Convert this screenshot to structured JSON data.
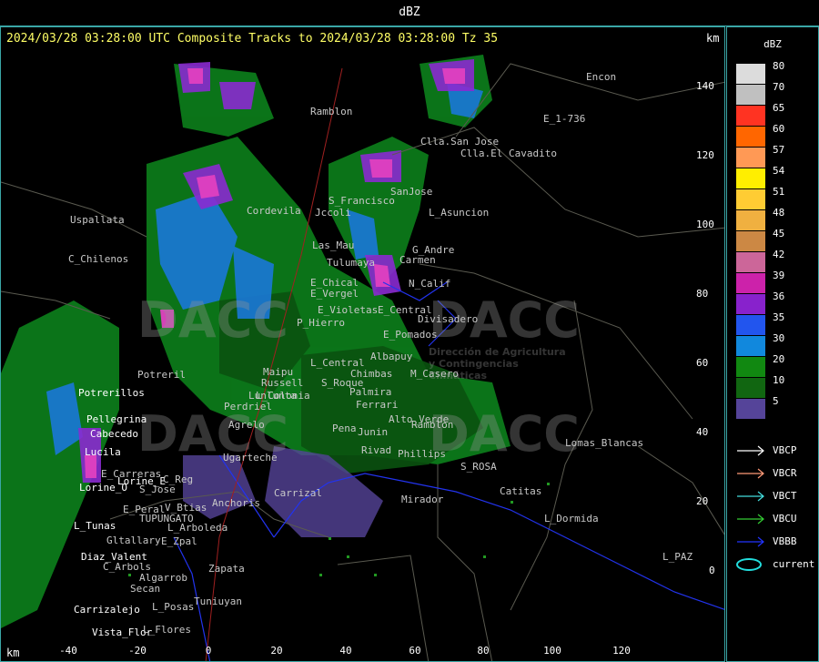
{
  "window": {
    "title": "dBZ"
  },
  "map": {
    "header": "2024/03/28 03:28:00 UTC Composite Tracks to 2024/03/28 03:28:00 Tz 35",
    "km_label": "km",
    "y_ticks": [
      "140",
      "120",
      "100",
      "80",
      "60",
      "40",
      "20",
      "0"
    ],
    "x_ticks": [
      "-40",
      "-20",
      "0",
      "20",
      "40",
      "60",
      "80",
      "100",
      "120"
    ],
    "places": [
      "Encon",
      "E_1-736",
      "Clla.San Jose",
      "Clla.El Cavadito",
      "SanJose",
      "L_Asuncion",
      "Ramblon",
      "Uspallata",
      "C_Chilenos",
      "Cordevila",
      "Jccoli",
      "S_Francisco",
      "G_Andre",
      "Carmen",
      "Las_Mau",
      "E_Chical",
      "E_Vergel",
      "Tulumaya",
      "N_Calif",
      "Divisadero",
      "E_Violetas",
      "E_Central",
      "P_Hierro",
      "Potrerillos",
      "Pellegrina",
      "Cabecedo",
      "Lucila",
      "Lorine_E",
      "Lorine_O",
      "L_Tunas",
      "Diaz_Valent",
      "Carrizalejo",
      "Vista_Flor",
      "Lomas_Blancas",
      "S_ROSA",
      "Catitas",
      "L_Dormida",
      "L_PAZ",
      "Mirador",
      "Carrizal",
      "Anchoris",
      "Zapata",
      "TUPUNGATO",
      "L_Arboleda",
      "Gltallary",
      "E_Zpal",
      "E_Peral",
      "V_Btias",
      "S_Jose",
      "L_Flores",
      "Tuniuyan",
      "C_Arbols",
      "Algarrob",
      "L_Posas",
      "Secan",
      "Junin",
      "Rivad",
      "Phillips",
      "Ramblon",
      "Alto_Verde",
      "Pena",
      "Palmira",
      "Perdriel",
      "Agrelo",
      "Ugarteche",
      "L_Colonia",
      "Chimbas",
      "M_Casero",
      "S_Roque",
      "Ferrari",
      "Albapuy",
      "L_Central",
      "E_Pomados",
      "Maipu",
      "Russell",
      "Lunlunta",
      "E_Carreras",
      "C_Reg",
      "Potreril"
    ],
    "watermark": "DACC",
    "watermark_sub": "Dirección de Agricultura y Contingencias Climáticas"
  },
  "legend": {
    "unit": "dBZ",
    "scale": [
      {
        "v": "80",
        "c": "#dcdcdc"
      },
      {
        "v": "70",
        "c": "#c0c0c0"
      },
      {
        "v": "65",
        "c": "#ff3322"
      },
      {
        "v": "60",
        "c": "#ff6600"
      },
      {
        "v": "57",
        "c": "#ff9955"
      },
      {
        "v": "54",
        "c": "#ffee00"
      },
      {
        "v": "51",
        "c": "#ffcc33"
      },
      {
        "v": "48",
        "c": "#f0b040"
      },
      {
        "v": "45",
        "c": "#cc8844"
      },
      {
        "v": "42",
        "c": "#cc6699"
      },
      {
        "v": "39",
        "c": "#cc22aa"
      },
      {
        "v": "36",
        "c": "#8822cc"
      },
      {
        "v": "35",
        "c": "#2255ee"
      },
      {
        "v": "30",
        "c": "#1188dd"
      },
      {
        "v": "20",
        "c": "#118811"
      },
      {
        "v": "10",
        "c": "#116611"
      },
      {
        "v": "5",
        "c": "#554499"
      }
    ],
    "tracks": [
      {
        "label": "VBCP",
        "color": "#ffffff"
      },
      {
        "label": "VBCR",
        "color": "#ff9977"
      },
      {
        "label": "VBCT",
        "color": "#44dddd"
      },
      {
        "label": "VBCU",
        "color": "#33cc33"
      },
      {
        "label": "VBBB",
        "color": "#2233ff"
      },
      {
        "label": "current",
        "color": "#22dddd"
      }
    ]
  }
}
